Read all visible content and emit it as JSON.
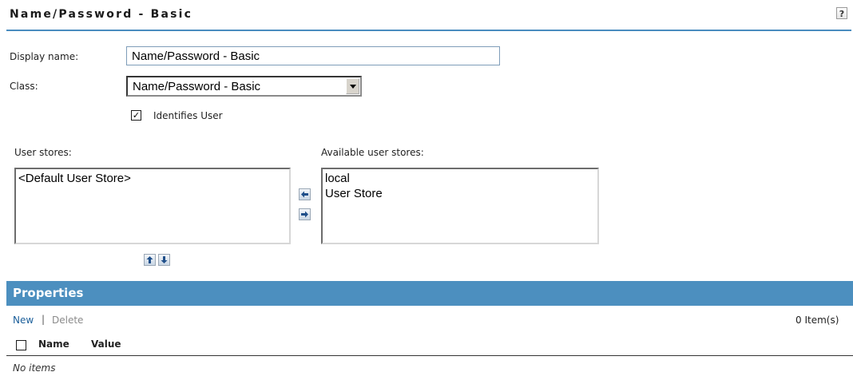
{
  "header": {
    "title": "Name/Password - Basic",
    "help_label": "?"
  },
  "form": {
    "display_name_label": "Display name:",
    "display_name_value": "Name/Password - Basic",
    "class_label": "Class:",
    "class_value": "Name/Password - Basic",
    "identifies_user_label": "Identifies User",
    "identifies_user_checked": true
  },
  "stores": {
    "user_stores_label": "User stores:",
    "user_stores": [
      "<Default User Store>"
    ],
    "available_label": "Available user stores:",
    "available": [
      "local",
      "User Store"
    ]
  },
  "properties": {
    "title": "Properties",
    "new_label": "New",
    "separator": "|",
    "delete_label": "Delete",
    "count_label": "0 Item(s)",
    "columns": [
      "Name",
      "Value"
    ],
    "empty_text": "No items"
  },
  "colors": {
    "accent": "#4c8fbf",
    "link": "#1a5e9a",
    "disabled_link": "#8a8a8a"
  },
  "icons": {
    "move_left": "arrow-left-icon",
    "move_right": "arrow-right-icon",
    "move_up": "arrow-up-icon",
    "move_down": "arrow-down-icon",
    "help": "help-icon"
  }
}
